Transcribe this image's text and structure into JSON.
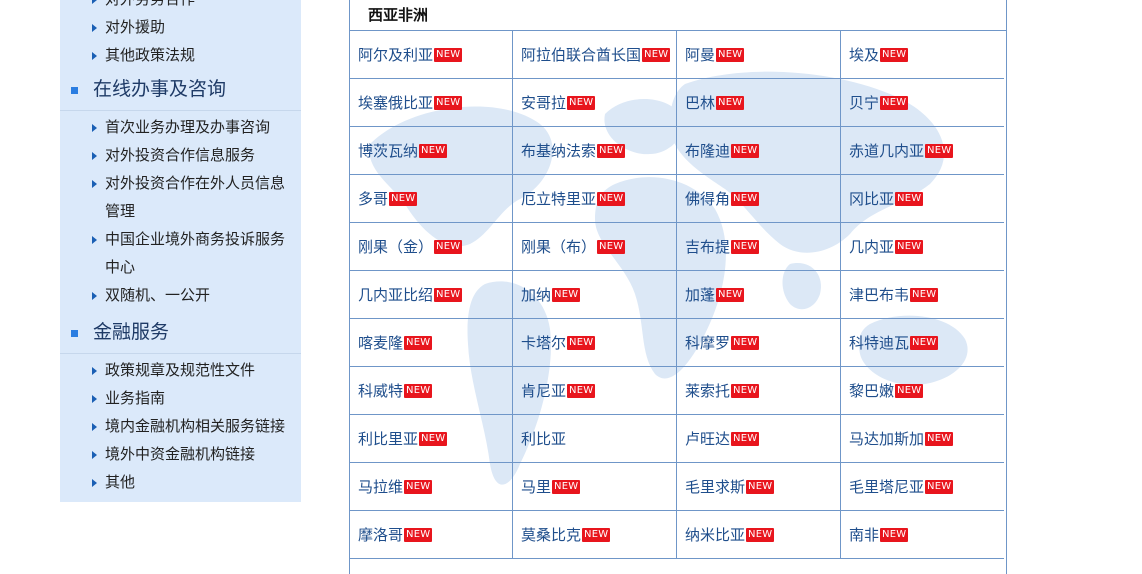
{
  "sidebar": {
    "group_top": [
      {
        "label": "对外劳务合作"
      },
      {
        "label": "对外援助"
      },
      {
        "label": "其他政策法规"
      }
    ],
    "section_online": {
      "title": "在线办事及咨询",
      "items": [
        {
          "label": "首次业务办理及办事咨询"
        },
        {
          "label": "对外投资合作信息服务"
        },
        {
          "label": "对外投资合作在外人员信息管理"
        },
        {
          "label": "中国企业境外商务投诉服务中心"
        },
        {
          "label": "双随机、一公开"
        }
      ]
    },
    "section_finance": {
      "title": "金融服务",
      "items": [
        {
          "label": "政策规章及规范性文件"
        },
        {
          "label": "业务指南"
        },
        {
          "label": "境内金融机构相关服务链接"
        },
        {
          "label": "境外中资金融机构链接"
        },
        {
          "label": "其他"
        }
      ]
    }
  },
  "main": {
    "region_title": "西亚非洲",
    "badge_text": "NEW",
    "countries": [
      {
        "name": "阿尔及利亚",
        "new": true
      },
      {
        "name": "阿拉伯联合酋长国",
        "new": true
      },
      {
        "name": "阿曼",
        "new": true
      },
      {
        "name": "埃及",
        "new": true
      },
      {
        "name": "埃塞俄比亚",
        "new": true
      },
      {
        "name": "安哥拉",
        "new": true
      },
      {
        "name": "巴林",
        "new": true
      },
      {
        "name": "贝宁",
        "new": true
      },
      {
        "name": "博茨瓦纳",
        "new": true
      },
      {
        "name": "布基纳法索",
        "new": true
      },
      {
        "name": "布隆迪",
        "new": true
      },
      {
        "name": "赤道几内亚",
        "new": true
      },
      {
        "name": "多哥",
        "new": true
      },
      {
        "name": "厄立特里亚",
        "new": true
      },
      {
        "name": "佛得角",
        "new": true
      },
      {
        "name": "冈比亚",
        "new": true
      },
      {
        "name": "刚果（金）",
        "new": true
      },
      {
        "name": "刚果（布）",
        "new": true
      },
      {
        "name": "吉布提",
        "new": true
      },
      {
        "name": "几内亚",
        "new": true
      },
      {
        "name": "几内亚比绍",
        "new": true
      },
      {
        "name": "加纳",
        "new": true
      },
      {
        "name": "加蓬",
        "new": true
      },
      {
        "name": "津巴布韦",
        "new": true
      },
      {
        "name": "喀麦隆",
        "new": true
      },
      {
        "name": "卡塔尔",
        "new": true
      },
      {
        "name": "科摩罗",
        "new": true
      },
      {
        "name": "科特迪瓦",
        "new": true
      },
      {
        "name": "科威特",
        "new": true
      },
      {
        "name": "肯尼亚",
        "new": true
      },
      {
        "name": "莱索托",
        "new": true
      },
      {
        "name": "黎巴嫩",
        "new": true
      },
      {
        "name": "利比里亚",
        "new": true
      },
      {
        "name": "利比亚",
        "new": false
      },
      {
        "name": "卢旺达",
        "new": true
      },
      {
        "name": "马达加斯加",
        "new": true
      },
      {
        "name": "马拉维",
        "new": true
      },
      {
        "name": "马里",
        "new": true
      },
      {
        "name": "毛里求斯",
        "new": true
      },
      {
        "name": "毛里塔尼亚",
        "new": true
      },
      {
        "name": "摩洛哥",
        "new": true
      },
      {
        "name": "莫桑比克",
        "new": true
      },
      {
        "name": "纳米比亚",
        "new": true
      },
      {
        "name": "南非",
        "new": true
      }
    ]
  },
  "colors": {
    "sidebar_bg": "#dbe9fa",
    "link": "#1f4e8c",
    "badge": "#e8151d",
    "grid_line": "#6f96c8",
    "map_tint": "#dce8f6"
  }
}
